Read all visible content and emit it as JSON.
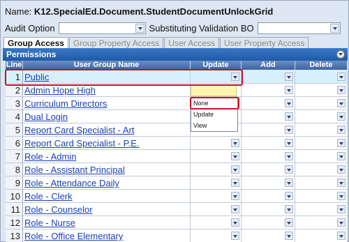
{
  "header": {
    "name_label": "Name:",
    "name_value": "K12.SpecialEd.Document.StudentDocumentUnlockGrid"
  },
  "options": {
    "audit_label": "Audit Option",
    "audit_value": "",
    "subst_label": "Substituting Validation BO",
    "subst_value": ""
  },
  "tabs": [
    {
      "label": "Group Access",
      "active": true
    },
    {
      "label": "Group Property Access",
      "active": false
    },
    {
      "label": "User Access",
      "active": false
    },
    {
      "label": "User Property Access",
      "active": false
    }
  ],
  "panel_title": "Permissions",
  "columns": {
    "line": "Line",
    "group": "User Group Name",
    "update": "Update",
    "add": "Add",
    "delete": "Delete"
  },
  "rows": [
    {
      "n": "1",
      "name": "Public"
    },
    {
      "n": "2",
      "name": "Admin Hope High"
    },
    {
      "n": "3",
      "name": "Curriculum Directors"
    },
    {
      "n": "4",
      "name": "Dual Login"
    },
    {
      "n": "5",
      "name": "Report Card Specialist - Art"
    },
    {
      "n": "6",
      "name": "Report Card Specialist - P.E."
    },
    {
      "n": "7",
      "name": "Role - Admin"
    },
    {
      "n": "8",
      "name": "Role - Assistant Principal"
    },
    {
      "n": "9",
      "name": "Role - Attendance Daily"
    },
    {
      "n": "10",
      "name": "Role - Clerk"
    },
    {
      "n": "11",
      "name": "Role - Counselor"
    },
    {
      "n": "12",
      "name": "Role - Nurse"
    },
    {
      "n": "13",
      "name": "Role - Office Elementary"
    }
  ],
  "dropdown_options": [
    "None",
    "Update",
    "View"
  ],
  "colors": {
    "header_blue": "#1e5aa8",
    "link": "#1a3fb8",
    "highlight": "#c8102e",
    "selected_row": "#d6f1fb"
  }
}
